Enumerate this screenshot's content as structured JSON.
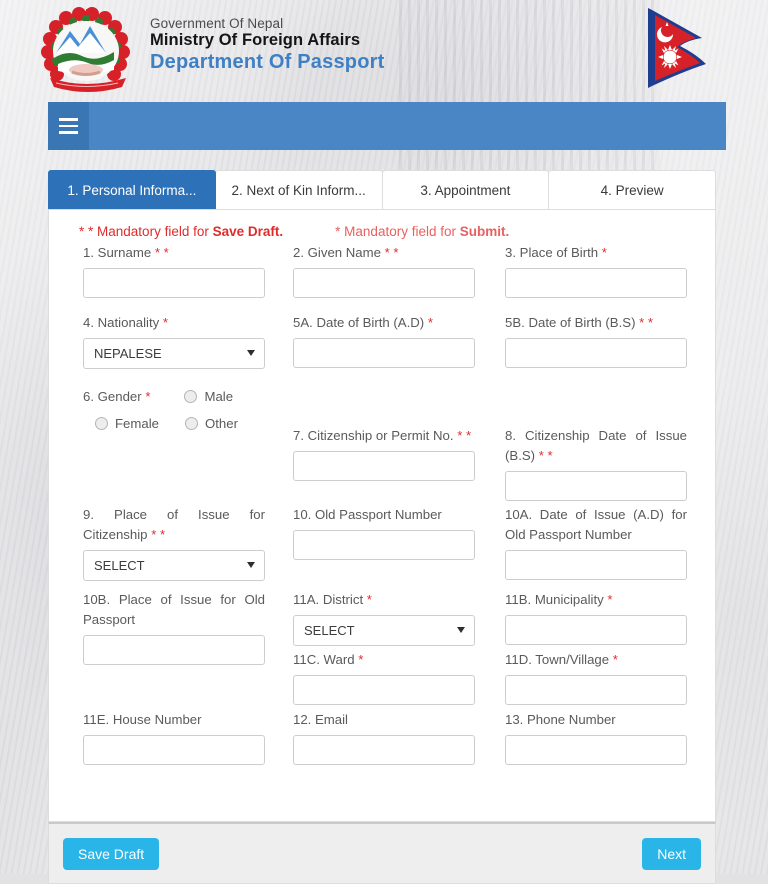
{
  "header": {
    "gov_line": "Government Of Nepal",
    "ministry_line": "Ministry Of Foreign Affairs",
    "department_line": "Department Of Passport",
    "emblem_icon": "nepal-emblem-icon",
    "flag_icon": "nepal-flag-icon"
  },
  "navbar": {
    "menu_icon": "hamburger-menu-icon",
    "background_color": "#4a86c5"
  },
  "tabs": [
    {
      "label": "1. Personal Informa...",
      "active": true
    },
    {
      "label": "2. Next of Kin Inform...",
      "active": false
    },
    {
      "label": "3. Appointment",
      "active": false
    },
    {
      "label": "4. Preview",
      "active": false
    }
  ],
  "notes": {
    "draft_stars": "* *",
    "draft_text": "Mandatory field for ",
    "draft_bold": "Save Draft.",
    "submit_stars": "*",
    "submit_text": "Mandatory field for ",
    "submit_bold": "Submit."
  },
  "fields": {
    "surname": {
      "label": "1. Surname",
      "req": "* *",
      "value": "",
      "placeholder": ""
    },
    "given_name": {
      "label": "2. Given Name",
      "req": "* *",
      "value": "",
      "placeholder": ""
    },
    "place_of_birth": {
      "label": "3. Place of Birth",
      "req": "*",
      "value": "",
      "placeholder": ""
    },
    "nationality": {
      "label": "4. Nationality",
      "req": "*",
      "value": "NEPALESE"
    },
    "dob_ad": {
      "label": "5A. Date of Birth (A.D)",
      "req": "*",
      "value": "",
      "placeholder": ""
    },
    "dob_bs": {
      "label": "5B. Date of Birth (B.S)",
      "req": "* *",
      "value": "",
      "placeholder": ""
    },
    "gender": {
      "label": "6. Gender",
      "req": "*",
      "options": [
        "Male",
        "Female",
        "Other"
      ],
      "selected": ""
    },
    "citizenship_no": {
      "label": "7. Citizenship or Permit No.",
      "req": "* *",
      "value": "",
      "placeholder": ""
    },
    "citizenship_issue_bs": {
      "label": "8. Citizenship Date of Issue (B.S)",
      "req": "* *",
      "value": "",
      "placeholder": ""
    },
    "place_issue_citizenship": {
      "label": "9. Place of Issue for Citizenship",
      "req": "* *",
      "value": "SELECT"
    },
    "old_passport_no": {
      "label": "10. Old Passport Number",
      "req": "",
      "value": "",
      "placeholder": ""
    },
    "old_passport_issue_ad": {
      "label": "10A. Date of Issue (A.D) for Old Passport Number",
      "req": "",
      "value": "",
      "placeholder": ""
    },
    "old_passport_place": {
      "label": "10B. Place of Issue for Old Passport",
      "req": "",
      "value": "",
      "placeholder": ""
    },
    "district": {
      "label": "11A. District",
      "req": "*",
      "value": "SELECT"
    },
    "municipality": {
      "label": "11B. Municipality",
      "req": "*",
      "value": "",
      "placeholder": ""
    },
    "ward": {
      "label": "11C. Ward",
      "req": "*",
      "value": "",
      "placeholder": ""
    },
    "town_village": {
      "label": "11D. Town/Village",
      "req": "*",
      "value": "",
      "placeholder": ""
    },
    "house_number": {
      "label": "11E. House Number",
      "req": "",
      "value": "",
      "placeholder": ""
    },
    "email": {
      "label": "12. Email",
      "req": "",
      "value": "",
      "placeholder": ""
    },
    "phone": {
      "label": "13. Phone Number",
      "req": "",
      "value": "",
      "placeholder": ""
    }
  },
  "footer": {
    "save_draft_label": "Save Draft",
    "next_label": "Next",
    "button_color": "#29b5e8"
  }
}
